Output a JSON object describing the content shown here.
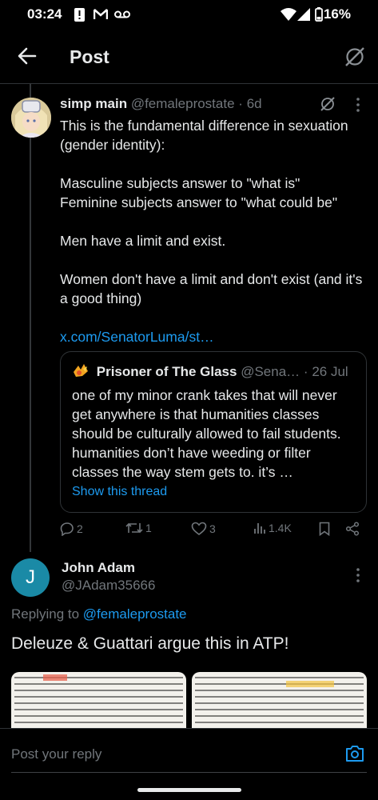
{
  "status_bar": {
    "time": "03:24",
    "battery": "16%",
    "icons": [
      "alert-icon",
      "gmail-icon",
      "voicemail-icon",
      "wifi-icon",
      "signal-icon",
      "battery-icon"
    ]
  },
  "header": {
    "title": "Post",
    "back_icon": "arrow-left-icon",
    "right_icon": "grok-icon"
  },
  "tweet": {
    "name": "simp main",
    "handle": "@femaleprostate",
    "separator": "·",
    "time": "6d",
    "paragraphs": [
      "This is the fundamental difference in sexuation (gender identity):",
      "Masculine subjects answer to \"what is\"",
      "Feminine subjects answer to \"what could be\"",
      "Men have a limit and exist.",
      "Women don't have a limit and don't exist (and it's a good thing)"
    ],
    "link": "x.com/SenatorLuma/st…",
    "quote": {
      "name": "Prisoner of The Glass",
      "handle": "@Sena…",
      "separator": "·",
      "date": "26 Jul",
      "text": "one of my minor crank takes that will never get anywhere is that humanities classes should be culturally allowed to fail students. humanities don’t have weeding or filter classes the way stem gets to. it’s …",
      "show_thread": "Show this thread"
    },
    "actions": {
      "replies": "2",
      "reposts": "1",
      "likes": "3",
      "views": "1.4K"
    }
  },
  "reply": {
    "avatar_letter": "J",
    "name": "John Adam",
    "handle": "@JAdam35666",
    "replying_prefix": "Replying to",
    "replying_handle": "@femaleprostate",
    "text": "Deleuze & Guattari argue this in ATP!"
  },
  "composer": {
    "placeholder": "Post your reply"
  },
  "colors": {
    "background": "#000000",
    "text": "#e7e9ea",
    "muted": "#71767b",
    "accent": "#1d9bf0",
    "border": "#2f3336"
  }
}
